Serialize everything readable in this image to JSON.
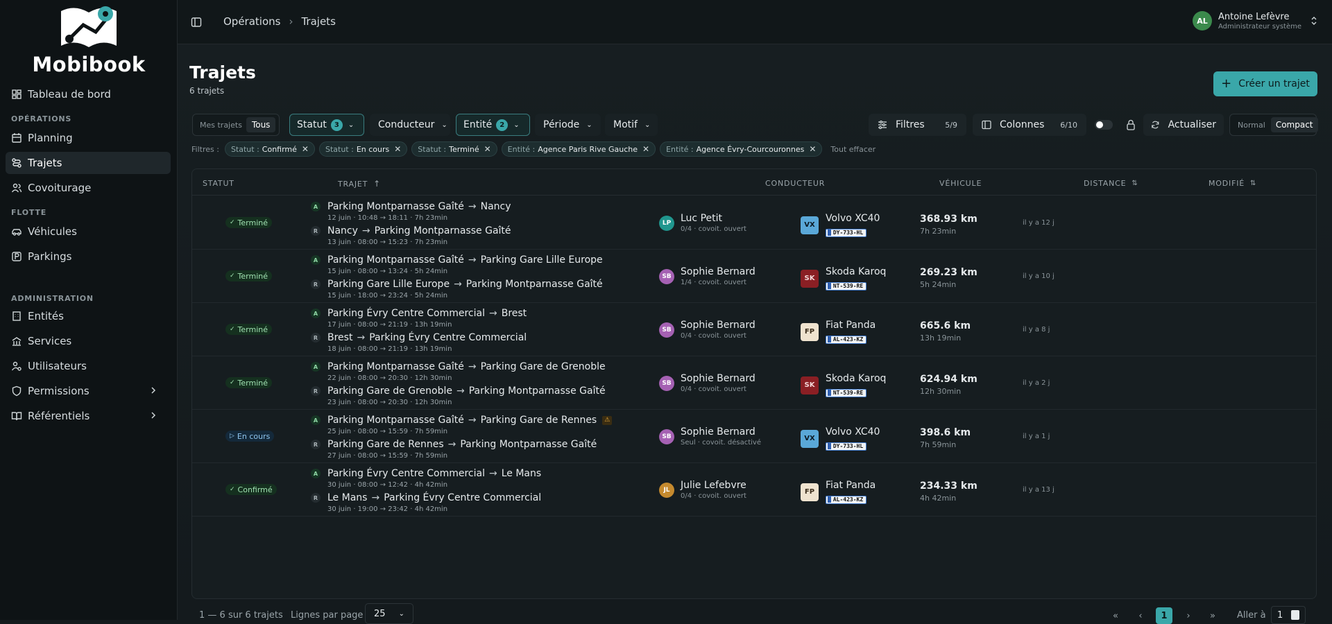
{
  "app": {
    "name": "Mobibook"
  },
  "sidebar": {
    "dashboard": "Tableau de bord",
    "section_operations": "OPÉRATIONS",
    "planning": "Planning",
    "trajets": "Trajets",
    "covoiturage": "Covoiturage",
    "section_flotte": "FLOTTE",
    "vehicules": "Véhicules",
    "parkings": "Parkings",
    "section_admin": "ADMINISTRATION",
    "entites": "Entités",
    "services": "Services",
    "utilisateurs": "Utilisateurs",
    "permissions": "Permissions",
    "referentiels": "Référentiels"
  },
  "header": {
    "crumb1": "Opérations",
    "crumb2": "Trajets",
    "user_initials": "AL",
    "user_name": "Antoine Lefèvre",
    "user_role": "Administrateur système"
  },
  "page": {
    "title": "Trajets",
    "count": "6 trajets",
    "create": "Créer un trajet"
  },
  "toolbar": {
    "mine": "Mes trajets",
    "all": "Tous",
    "statut": "Statut",
    "statut_count": "3",
    "conducteur": "Conducteur",
    "entite": "Entité",
    "entite_count": "2",
    "periode": "Période",
    "motif": "Motif",
    "filtres": "Filtres",
    "filtres_count": "5/9",
    "colonnes": "Colonnes",
    "colonnes_count": "6/10",
    "refresh": "Actualiser",
    "normal": "Normal",
    "compact": "Compact"
  },
  "chips": {
    "label": "Filtres :",
    "c1k": "Statut :",
    "c1v": "Confirmé",
    "c2k": "Statut :",
    "c2v": "En cours",
    "c3k": "Statut :",
    "c3v": "Terminé",
    "c4k": "Entité :",
    "c4v": "Agence Paris Rive Gauche",
    "c5k": "Entité :",
    "c5v": "Agence Évry-Courcouronnes",
    "clear": "Tout effacer"
  },
  "columns": {
    "statut": "STATUT",
    "trajet": "TRAJET",
    "conducteur": "CONDUCTEUR",
    "vehicule": "VÉHICULE",
    "distance": "DISTANCE",
    "modifie": "MODIFIÉ"
  },
  "leg_tags": {
    "aller": "A",
    "retour": "R"
  },
  "rows": [
    {
      "status": "Terminé",
      "a_from": "Parking Montparnasse Gaîté",
      "a_to": "Nancy",
      "a_sub": "12 juin · 10:48 → 18:11 · 7h 23min",
      "r_from": "Nancy",
      "r_to": "Parking Montparnasse Gaîté",
      "r_sub": "13 juin · 08:00 → 15:23 · 7h 23min",
      "driver_initials": "LP",
      "driver": "Luc Petit",
      "driver_sub": "0/4 · covoit. ouvert",
      "veh_initials": "VX",
      "vehicle": "Volvo XC40",
      "plate": "DY-733-HL",
      "distance": "368.93 km",
      "duration": "7h 23min",
      "modified": "il y a 12 j"
    },
    {
      "status": "Terminé",
      "a_from": "Parking Montparnasse Gaîté",
      "a_to": "Parking Gare Lille Europe",
      "a_sub": "15 juin · 08:00 → 13:24 · 5h 24min",
      "r_from": "Parking Gare Lille Europe",
      "r_to": "Parking Montparnasse Gaîté",
      "r_sub": "15 juin · 18:00 → 23:24 · 5h 24min",
      "driver_initials": "SB",
      "driver": "Sophie Bernard",
      "driver_sub": "1/4 · covoit. ouvert",
      "veh_initials": "SK",
      "vehicle": "Skoda Karoq",
      "plate": "NT-539-RE",
      "distance": "269.23 km",
      "duration": "5h 24min",
      "modified": "il y a 10 j"
    },
    {
      "status": "Terminé",
      "a_from": "Parking Évry Centre Commercial",
      "a_to": "Brest",
      "a_sub": "17 juin · 08:00 → 21:19 · 13h 19min",
      "r_from": "Brest",
      "r_to": "Parking Évry Centre Commercial",
      "r_sub": "18 juin · 08:00 → 21:19 · 13h 19min",
      "driver_initials": "SB",
      "driver": "Sophie Bernard",
      "driver_sub": "0/4 · covoit. ouvert",
      "veh_initials": "FP",
      "vehicle": "Fiat Panda",
      "plate": "AL-423-KZ",
      "distance": "665.6 km",
      "duration": "13h 19min",
      "modified": "il y a 8 j"
    },
    {
      "status": "Terminé",
      "a_from": "Parking Montparnasse Gaîté",
      "a_to": "Parking Gare de Grenoble",
      "a_sub": "22 juin · 08:00 → 20:30 · 12h 30min",
      "r_from": "Parking Gare de Grenoble",
      "r_to": "Parking Montparnasse Gaîté",
      "r_sub": "23 juin · 08:00 → 20:30 · 12h 30min",
      "driver_initials": "SB",
      "driver": "Sophie Bernard",
      "driver_sub": "0/4 · covoit. ouvert",
      "veh_initials": "SK",
      "vehicle": "Skoda Karoq",
      "plate": "NT-539-RE",
      "distance": "624.94 km",
      "duration": "12h 30min",
      "modified": "il y a 2 j"
    },
    {
      "status": "En cours",
      "a_from": "Parking Montparnasse Gaîté",
      "a_to": "Parking Gare de Rennes",
      "a_sub": "25 juin · 08:00 → 15:59 · 7h 59min",
      "r_from": "Parking Gare de Rennes",
      "r_to": "Parking Montparnasse Gaîté",
      "r_sub": "27 juin · 08:00 → 15:59 · 7h 59min",
      "driver_initials": "SB",
      "driver": "Sophie Bernard",
      "driver_sub": "Seul · covoit. désactivé",
      "veh_initials": "VX",
      "vehicle": "Volvo XC40",
      "plate": "DY-733-HL",
      "distance": "398.6 km",
      "duration": "7h 59min",
      "modified": "il y a 1 j"
    },
    {
      "status": "Confirmé",
      "a_from": "Parking Évry Centre Commercial",
      "a_to": "Le Mans",
      "a_sub": "30 juin · 08:00 → 12:42 · 4h 42min",
      "r_from": "Le Mans",
      "r_to": "Parking Évry Centre Commercial",
      "r_sub": "30 juin · 19:00 → 23:42 · 4h 42min",
      "driver_initials": "JL",
      "driver": "Julie Lefebvre",
      "driver_sub": "0/4 · covoit. ouvert",
      "veh_initials": "FP",
      "vehicle": "Fiat Panda",
      "plate": "AL-423-KZ",
      "distance": "234.33 km",
      "duration": "4h 42min",
      "modified": "il y a 13 j"
    }
  ],
  "footer": {
    "range": "1 — 6 sur 6 trajets",
    "per_page_label": "Lignes par page",
    "per_page": "25",
    "page": "1",
    "goto_label": "Aller à",
    "goto_value": "1"
  },
  "colors": {
    "accent": "#3aa7a9"
  }
}
